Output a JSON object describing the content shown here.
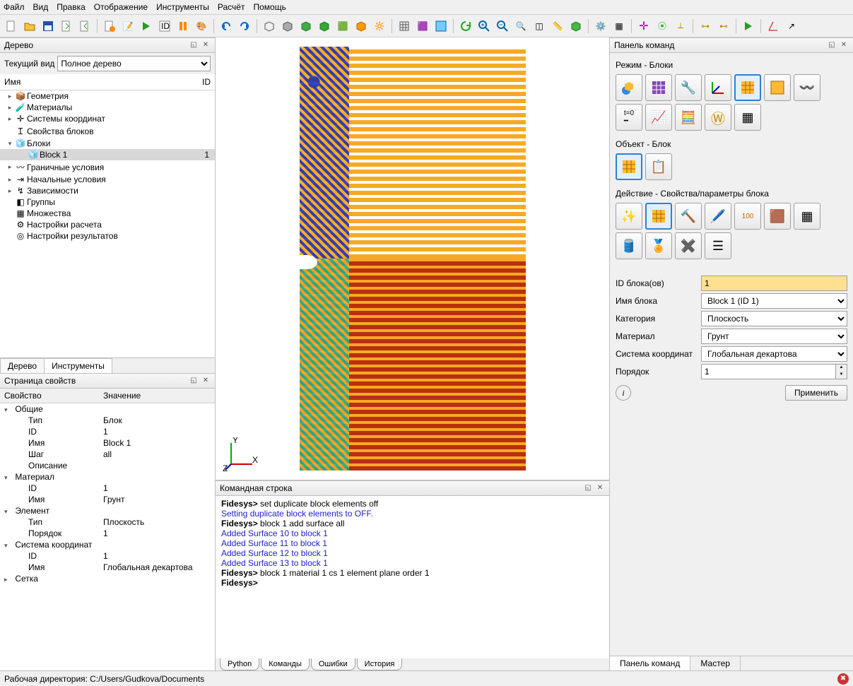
{
  "menu": [
    "Файл",
    "Вид",
    "Правка",
    "Отображение",
    "Инструменты",
    "Расчёт",
    "Помощь"
  ],
  "panels": {
    "tree": "Дерево",
    "props": "Страница свойств",
    "cmd": "Командная строка",
    "cmdpanel": "Панель команд"
  },
  "tree": {
    "view_label": "Текущий вид",
    "view_value": "Полное дерево",
    "col_name": "Имя",
    "col_id": "ID",
    "items": [
      {
        "label": "Геометрия",
        "exp": "▸",
        "ico": "📦"
      },
      {
        "label": "Материалы",
        "exp": "▸",
        "ico": "🧪"
      },
      {
        "label": "Системы координат",
        "exp": "▸",
        "ico": "✛"
      },
      {
        "label": "Свойства блоков",
        "exp": "",
        "ico": "Ｉ"
      },
      {
        "label": "Блоки",
        "exp": "▾",
        "ico": "🧊"
      },
      {
        "label": "Block 1",
        "exp": "",
        "ico": "🧊",
        "indent": 1,
        "sel": true,
        "id": "1"
      },
      {
        "label": "Граничные условия",
        "exp": "▸",
        "ico": "〰"
      },
      {
        "label": "Начальные условия",
        "exp": "▸",
        "ico": "⇥"
      },
      {
        "label": "Зависимости",
        "exp": "▸",
        "ico": "↯"
      },
      {
        "label": "Группы",
        "exp": "",
        "ico": "◧"
      },
      {
        "label": "Множества",
        "exp": "",
        "ico": "▦"
      },
      {
        "label": "Настройки расчета",
        "exp": "",
        "ico": "⚙"
      },
      {
        "label": "Настройки результатов",
        "exp": "",
        "ico": "◎"
      }
    ],
    "tabs": [
      "Дерево",
      "Инструменты"
    ]
  },
  "props": {
    "col_prop": "Свойство",
    "col_val": "Значение",
    "groups": [
      {
        "name": "Общие",
        "rows": [
          [
            "Тип",
            "Блок"
          ],
          [
            "ID",
            "1"
          ],
          [
            "Имя",
            "Block 1"
          ],
          [
            "Шаг",
            "all"
          ],
          [
            "Описание",
            ""
          ]
        ]
      },
      {
        "name": "Материал",
        "rows": [
          [
            "ID",
            "1"
          ],
          [
            "Имя",
            "Грунт"
          ]
        ]
      },
      {
        "name": "Элемент",
        "rows": [
          [
            "Тип",
            "Плоскость"
          ],
          [
            "Порядок",
            "1"
          ]
        ]
      },
      {
        "name": "Система координат",
        "rows": [
          [
            "ID",
            "1"
          ],
          [
            "Имя",
            "Глобальная декартова"
          ]
        ]
      },
      {
        "name": "Сетка",
        "rows": []
      }
    ]
  },
  "cmd": {
    "lines": [
      {
        "t": "Fidesys> ",
        "cls": "bold",
        "tail": "set duplicate block elements off"
      },
      {
        "t": "Setting duplicate block elements to OFF.",
        "cls": "blue"
      },
      {
        "t": ""
      },
      {
        "t": "Fidesys> ",
        "cls": "bold",
        "tail": "block 1 add surface all"
      },
      {
        "t": "Added Surface 10 to block 1",
        "cls": "blue"
      },
      {
        "t": "Added Surface 11 to block 1",
        "cls": "blue"
      },
      {
        "t": "Added Surface 12 to block 1",
        "cls": "blue"
      },
      {
        "t": "Added Surface 13 to block 1",
        "cls": "blue"
      },
      {
        "t": ""
      },
      {
        "t": "Fidesys> ",
        "cls": "bold",
        "tail": "block 1 material 1 cs 1 element plane order 1"
      },
      {
        "t": ""
      },
      {
        "t": "Fidesys>",
        "cls": "bold"
      }
    ],
    "tabs": [
      "Python",
      "Команды",
      "Ошибки",
      "История"
    ]
  },
  "right": {
    "mode_label": "Режим - Блоки",
    "object_label": "Объект - Блок",
    "action_label": "Действие - Свойства/параметры блока",
    "form": {
      "id_label": "ID блока(ов)",
      "id_value": "1",
      "name_label": "Имя блока",
      "name_value": "Block 1 (ID 1)",
      "cat_label": "Категория",
      "cat_value": "Плоскость",
      "mat_label": "Материал",
      "mat_value": "Грунт",
      "cs_label": "Система координат",
      "cs_value": "Глобальная декартова",
      "order_label": "Порядок",
      "order_value": "1",
      "apply": "Применить"
    },
    "bottom_tabs": [
      "Панель команд",
      "Мастер"
    ]
  },
  "status": {
    "workdir_label": "Рабочая директория:",
    "workdir_path": "C:/Users/Gudkova/Documents"
  },
  "axis": {
    "y": "Y",
    "x": "X",
    "z": "Z"
  }
}
